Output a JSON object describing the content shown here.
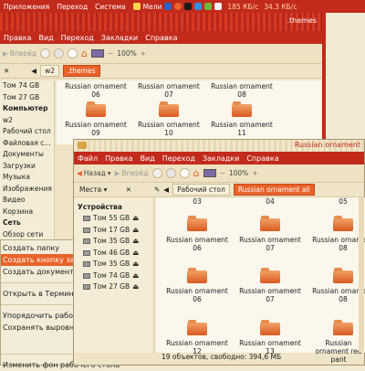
{
  "panel": {
    "menu": [
      "Приложения",
      "Переход",
      "Система"
    ],
    "mail": "Мели",
    "speed_down": "185 КБ/с",
    "speed_up": "34.3 КБ/с"
  },
  "win1": {
    "title": ".themes",
    "menu": [
      "Правка",
      "Вид",
      "Переход",
      "Закладки",
      "Справка"
    ],
    "toolbar": {
      "forward": "Вперёд",
      "zoom": "100%"
    },
    "path": [
      "w2",
      ".themes"
    ],
    "sidebar": [
      "Том 74 GB",
      "Том 27 GB",
      "Компьютер",
      "w2",
      "Рабочий стол",
      "Файловая с...",
      "Документы",
      "Загрузки",
      "Музыка",
      "Изображения",
      "Видео",
      "Корзина",
      "Сеть",
      "Обзор сети"
    ],
    "icons_row1": [
      "Russian ornament 06",
      "Russian ornament 07",
      "Russian ornament 08"
    ],
    "icons_row2": [
      "Russian ornament 09",
      "Russian ornament 10",
      "Russian ornament 11"
    ]
  },
  "context_menu": {
    "items": [
      "Создать папку",
      "Создать кнопку запуска...",
      "Создать документ",
      "Открыть в Терминале",
      "Упорядочить рабочий стол по имени",
      "Сохранять выровненными",
      "Изменить фон рабочего стола"
    ]
  },
  "win2": {
    "title": "Russian ornament",
    "menu": [
      "Файл",
      "Правка",
      "Вид",
      "Переход",
      "Закладки",
      "Справка"
    ],
    "toolbar": {
      "back": "Назад",
      "forward": "Вперёд",
      "zoom": "100%"
    },
    "places": "Места",
    "path": [
      "Рабочий стол",
      "Russian ornament all"
    ],
    "devices_header": "Устройства",
    "devices": [
      "Том 55 GB",
      "Том 17 GB",
      "Том 35 GB",
      "Том 46 GB",
      "Том 35 GB",
      "Том 74 GB",
      "Том 27 GB"
    ],
    "top_row_labels": [
      "03",
      "04",
      "05"
    ],
    "icons_row1": [
      "Russian ornament 06",
      "Russian ornament 07",
      "Russian ornament 08"
    ],
    "icons_row2": [
      "Russian ornament 12",
      "Russian ornament 13",
      "Russian ornament red pant"
    ],
    "status": "19 объектов, свободно: 394,6 МБ"
  }
}
